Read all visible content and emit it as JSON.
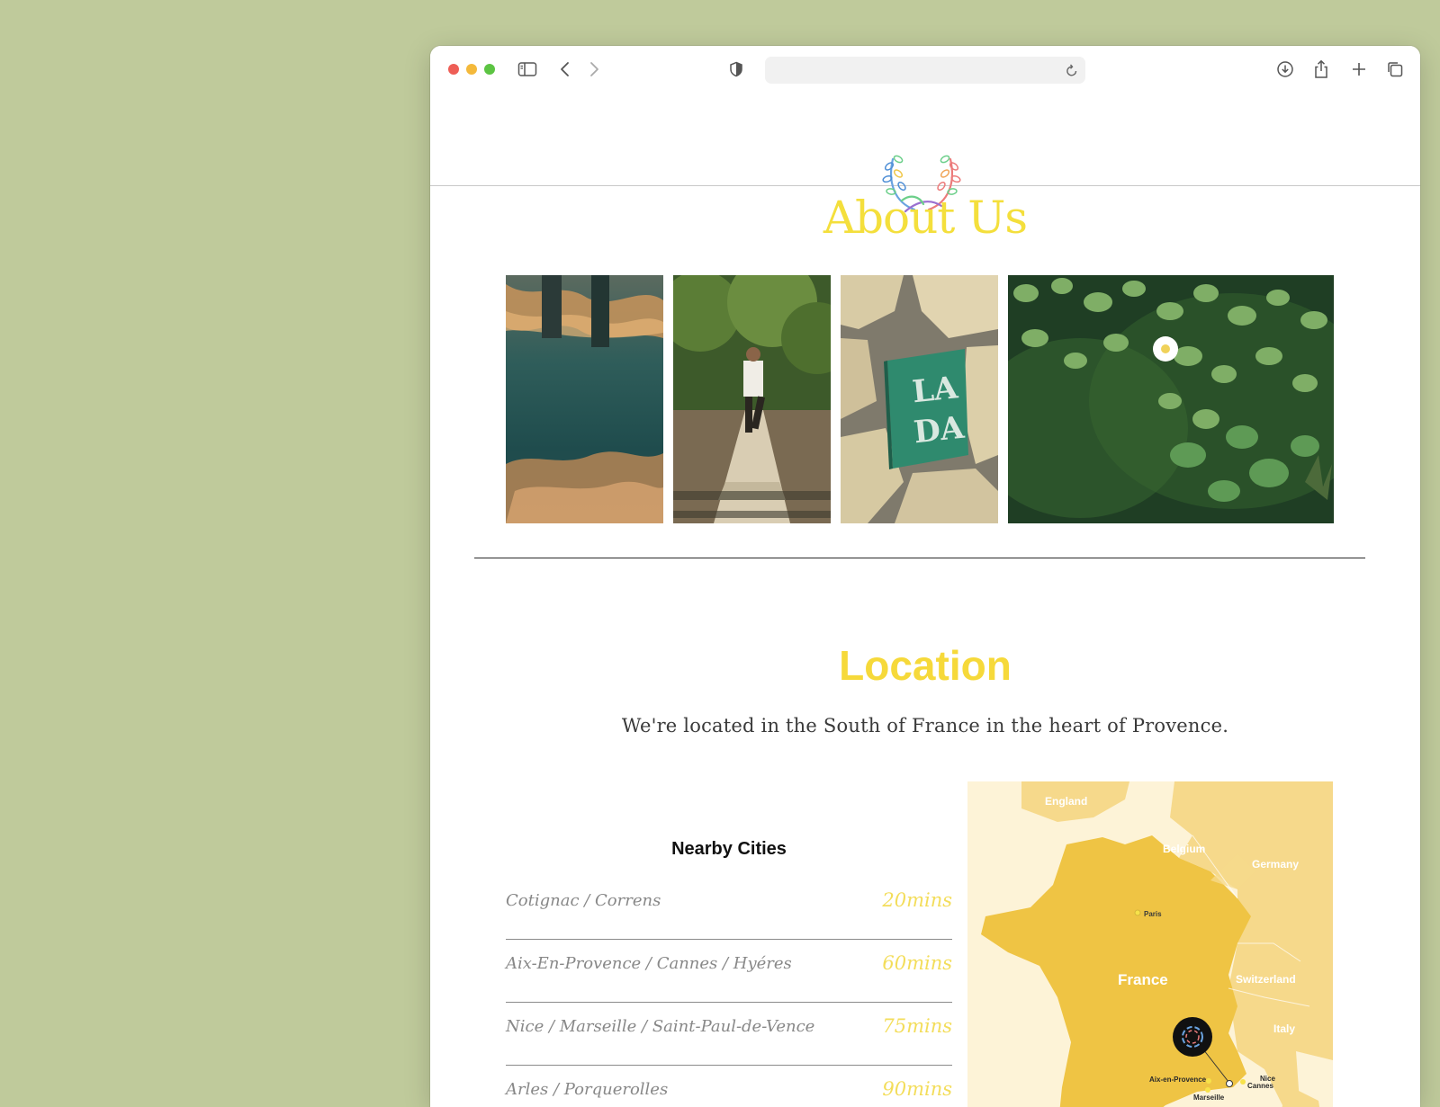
{
  "browser": {
    "address_value": ""
  },
  "header": {
    "title": "About Us"
  },
  "location": {
    "title": "Location",
    "subtitle": "We're located in the South of France in the heart of Provence.",
    "nearby_title": "Nearby Cities",
    "cities": [
      {
        "name": "Cotignac / Correns",
        "time": "20mins"
      },
      {
        "name": "Aix-En-Provence / Cannes / Hyéres",
        "time": "60mins"
      },
      {
        "name": "Nice / Marseille / Saint-Paul-de-Vence",
        "time": "75mins"
      },
      {
        "name": "Arles / Porquerolles",
        "time": "90mins"
      }
    ]
  },
  "map": {
    "labels": {
      "england": "England",
      "belgium": "Belgium",
      "germany": "Germany",
      "paris": "Paris",
      "france": "France",
      "switzerland": "Switzerland",
      "italy": "Italy",
      "aix": "Aix-en-Provence",
      "marseille": "Marseille",
      "nice": "Nice",
      "cannes": "Cannes"
    }
  },
  "colors": {
    "accent_yellow": "#f6d93a",
    "page_background": "#bfca9b",
    "map_france": "#efc444",
    "map_land": "#f6d98b",
    "map_sea": "#fdf3d7"
  }
}
